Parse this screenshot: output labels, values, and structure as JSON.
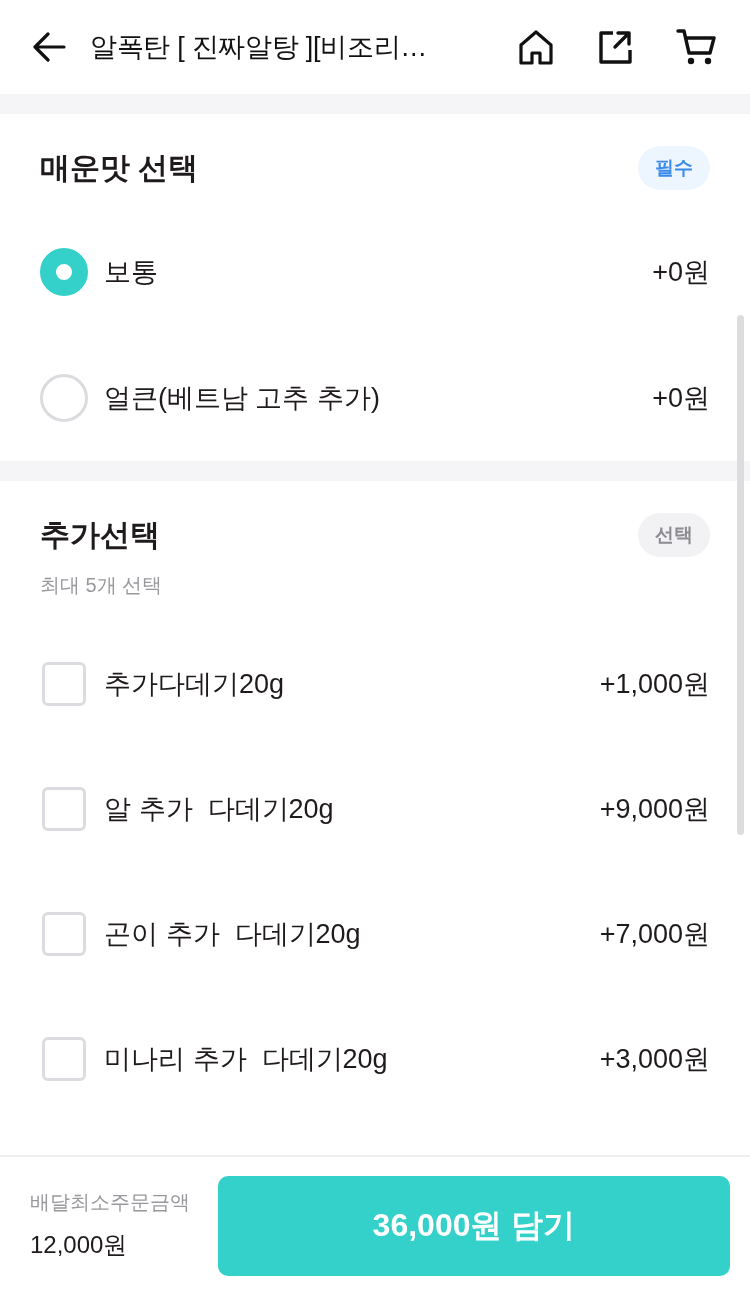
{
  "header": {
    "title": "알폭탄 [ 진짜알탕 ][비조리…"
  },
  "sections": [
    {
      "title": "매운맛 선택",
      "badge": {
        "label": "필수",
        "kind": "required"
      },
      "options": [
        {
          "kind": "radio",
          "label": "보통",
          "price": "+0원",
          "selected": true
        },
        {
          "kind": "radio",
          "label": "얼큰(베트남 고추 추가)",
          "price": "+0원",
          "selected": false
        }
      ]
    },
    {
      "title": "추가선택",
      "badge": {
        "label": "선택",
        "kind": "optional"
      },
      "subtitle": "최대 5개 선택",
      "options": [
        {
          "kind": "checkbox",
          "label": "추가다데기20g",
          "price": "+1,000원",
          "checked": false
        },
        {
          "kind": "checkbox",
          "label": "알 추가  다데기20g",
          "price": "+9,000원",
          "checked": false
        },
        {
          "kind": "checkbox",
          "label": "곤이 추가  다데기20g",
          "price": "+7,000원",
          "checked": false
        },
        {
          "kind": "checkbox",
          "label": "미나리 추가  다데기20g",
          "price": "+3,000원",
          "checked": false
        }
      ]
    }
  ],
  "footer": {
    "min_order_label": "배달최소주문금액",
    "min_order_amount": "12,000원",
    "add_button": "36,000원 담기"
  }
}
